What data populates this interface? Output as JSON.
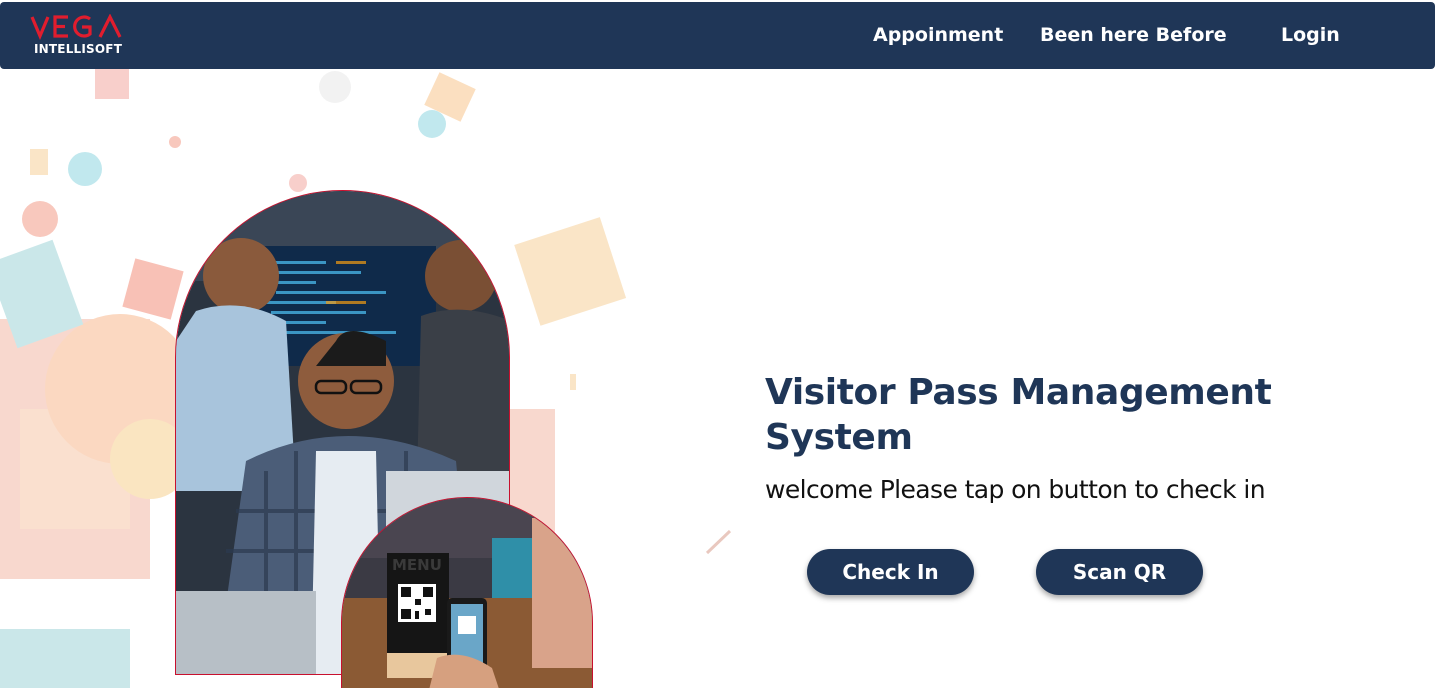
{
  "brand": {
    "logo_text": "VEGA",
    "logo_subtext": "INTELLISOFT",
    "accent_color": "#c8102e",
    "primary_color": "#1f3657"
  },
  "nav": {
    "items": [
      {
        "label": "Appoinment",
        "icon": ""
      },
      {
        "label": "Been here Before",
        "icon": ""
      },
      {
        "label": "Login",
        "icon": ""
      }
    ]
  },
  "hero": {
    "title": "Visitor Pass Management System",
    "subtitle": "welcome Please tap on button to check in",
    "buttons": {
      "check_in": "Check In",
      "scan_qr": "Scan QR"
    }
  },
  "images": {
    "main": "team-working-at-laptop-photo",
    "secondary": "phone-scanning-qr-menu-photo",
    "qr_sign_text": "MENU"
  }
}
